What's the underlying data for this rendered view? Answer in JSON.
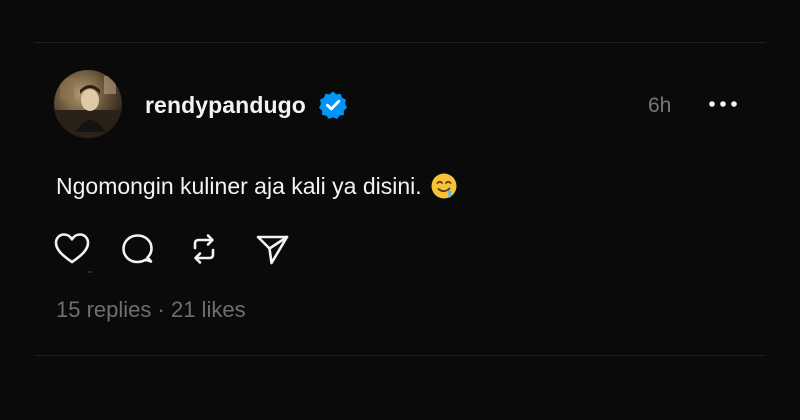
{
  "post": {
    "author": {
      "username": "rendypandugo",
      "verified": true,
      "avatar_icon": "avatar-photo"
    },
    "timestamp": "6h",
    "more_icon": "more-horizontal-icon",
    "text": "Ngomongin kuliner aja kali ya disini.",
    "emoji": "🤤",
    "actions": [
      {
        "name": "like",
        "icon": "heart-icon"
      },
      {
        "name": "reply",
        "icon": "comment-icon"
      },
      {
        "name": "repost",
        "icon": "repost-icon"
      },
      {
        "name": "share",
        "icon": "send-icon"
      }
    ],
    "stats": {
      "replies": "15 replies",
      "separator": "·",
      "likes": "21 likes"
    }
  },
  "colors": {
    "background": "#0a0a0a",
    "text_primary": "#f3f3f3",
    "text_secondary": "#6f6f6f",
    "verified_blue": "#0095f6",
    "divider": "#1f1f1f"
  }
}
